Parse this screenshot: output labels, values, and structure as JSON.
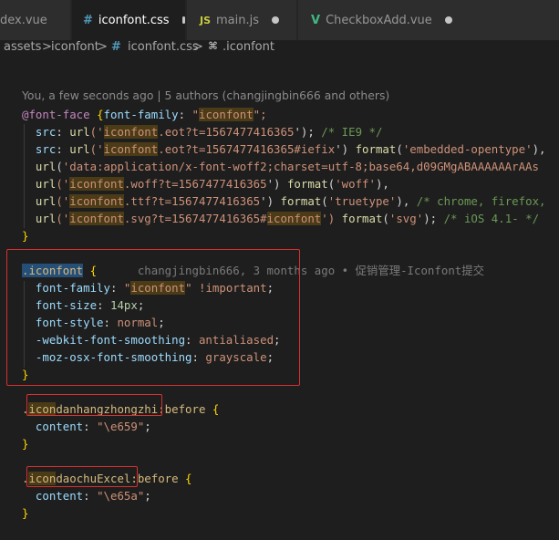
{
  "tabs": [
    {
      "label": "dex.vue",
      "icon": "",
      "modified": false,
      "active": false
    },
    {
      "label": "iconfont.css",
      "icon": "#",
      "modified": true,
      "active": true
    },
    {
      "label": "main.js",
      "icon": "JS",
      "modified": true,
      "active": false
    },
    {
      "label": "CheckboxAdd.vue",
      "icon": "V",
      "modified": true,
      "active": false
    }
  ],
  "breadcrumb": {
    "part1": "assets",
    "sep1": ">",
    "part2": "iconfont",
    "sep2": ">",
    "icon2": "#",
    "part3": "iconfont.css",
    "sep3": ">",
    "icon3": "⌘",
    "part4": ".iconfont"
  },
  "blame": "You, a few seconds ago | 5 authors (changjingbin666 and others)",
  "code": {
    "l1": {
      "a": "@font-face",
      "b": " {",
      "c": "font-family",
      "d": ": ",
      "e": "\"",
      "f": "iconfont",
      "g": "\";"
    },
    "l2": {
      "a": "  src",
      "b": ": ",
      "c": "url",
      "d": "('",
      "e": "iconfont",
      "f": ".eot?t=1567477416365",
      "g": "'); ",
      "h": "/* IE9 */"
    },
    "l3": {
      "a": "  src",
      "b": ": ",
      "c": "url",
      "d": "('",
      "e": "iconfont",
      "f": ".eot?t=1567477416365#iefix",
      "g": "') ",
      "h": "format",
      "i": "(",
      "j": "'embedded-opentype'",
      "k": "),"
    },
    "l4": {
      "a": "  ",
      "b": "url",
      "c": "(",
      "d": "'data:application/x-font-woff2;charset=utf-8;base64,d09GMgABAAAAAArAAs"
    },
    "l5": {
      "a": "  ",
      "b": "url",
      "c": "('",
      "d": "iconfont",
      "e": ".woff?t=1567477416365",
      "f": "') ",
      "g": "format",
      "h": "(",
      "i": "'woff'",
      "j": "),"
    },
    "l6": {
      "a": "  ",
      "b": "url",
      "c": "('",
      "d": "iconfont",
      "e": ".ttf?t=1567477416365",
      "f": "') ",
      "g": "format",
      "h": "(",
      "i": "'truetype'",
      "j": "), ",
      "k": "/* chrome, firefox,"
    },
    "l7": {
      "a": "  ",
      "b": "url",
      "c": "('",
      "d": "iconfont",
      "e": ".svg?t=1567477416365#",
      "f": "iconfont",
      "g": "') ",
      "h": "format",
      "i": "(",
      "j": "'svg'",
      "k": "); ",
      "l": "/* iOS 4.1- */"
    },
    "l8": {
      "a": "}"
    },
    "l9": {
      "a": ".iconfont",
      "b": " {",
      "c": "      changjingbin666, 3 months ago • 促销管理-Iconfont提交"
    },
    "l10": {
      "a": "  font-family",
      "b": ": ",
      "c": "\"",
      "d": "iconfont",
      "e": "\" ",
      "f": "!important",
      "g": ";"
    },
    "l11": {
      "a": "  font-size",
      "b": ": ",
      "c": "14px",
      "d": ";"
    },
    "l12": {
      "a": "  font-style",
      "b": ": ",
      "c": "normal",
      "d": ";"
    },
    "l13": {
      "a": "  -webkit-font-smoothing",
      "b": ": ",
      "c": "antialiased",
      "d": ";"
    },
    "l14": {
      "a": "  -moz-osx-font-smoothing",
      "b": ": ",
      "c": "grayscale",
      "d": ";"
    },
    "l15": {
      "a": "}"
    },
    "l16": {
      "a": ".",
      "b": "icon",
      "c": "danhangzhongzhi",
      "d": ":before",
      "e": " {"
    },
    "l17": {
      "a": "  content",
      "b": ": ",
      "c": "\"\\e659\"",
      "d": ";"
    },
    "l18": {
      "a": "}"
    },
    "l19": {
      "a": ".",
      "b": "icon",
      "c": "daochuExcel",
      "d": ":before",
      "e": " {"
    },
    "l20": {
      "a": "  content",
      "b": ": ",
      "c": "\"\\e65a\"",
      "d": ";"
    },
    "l21": {
      "a": "}"
    }
  },
  "colors": {
    "annotation_box": "#d8302f",
    "background": "#1e1e1e"
  }
}
